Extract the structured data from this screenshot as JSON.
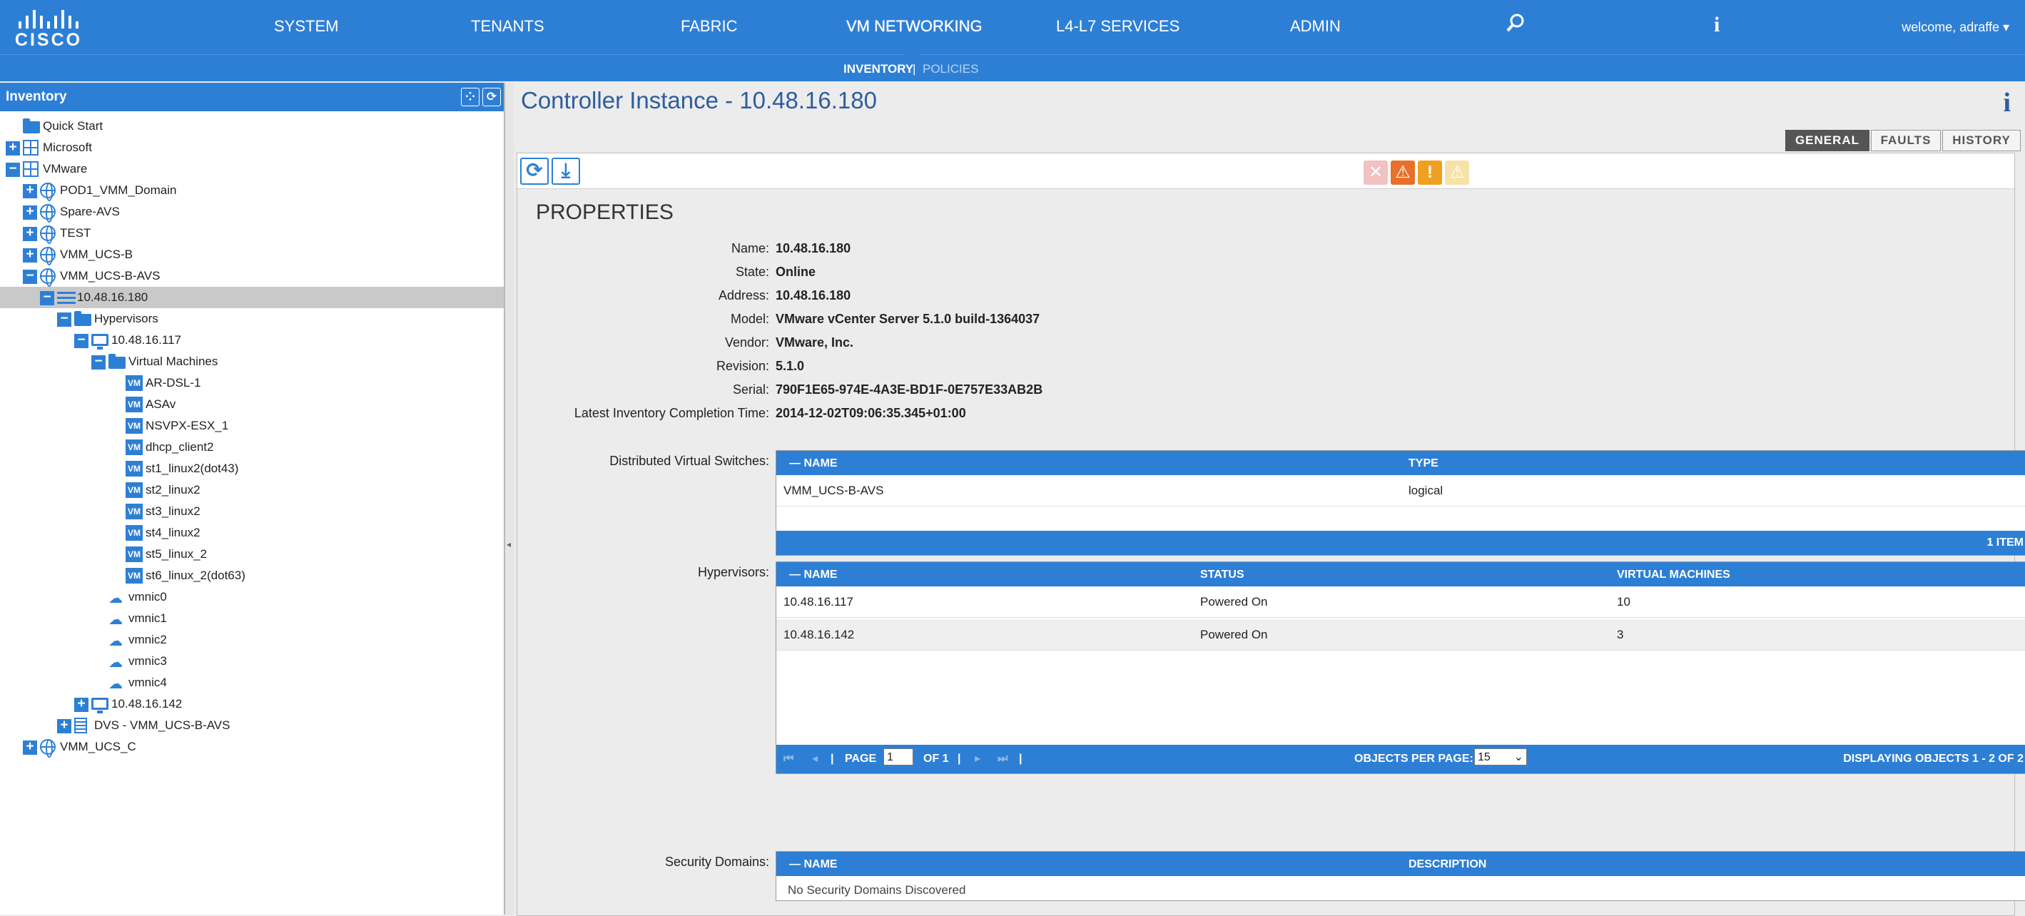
{
  "topnav": {
    "logo": "CISCO",
    "items": [
      "SYSTEM",
      "TENANTS",
      "FABRIC",
      "VM NETWORKING",
      "L4-L7 SERVICES",
      "ADMIN"
    ],
    "user": "welcome, adraffe ▾"
  },
  "subnav": {
    "inventory": "INVENTORY",
    "sep": "|",
    "policies": "POLICIES"
  },
  "left": {
    "title": "Inventory",
    "tree": [
      {
        "label": "Quick Start",
        "icon": "folder-icon",
        "level": 0,
        "toggle": ""
      },
      {
        "label": "Microsoft",
        "icon": "grid-icon",
        "level": 0,
        "toggle": "+"
      },
      {
        "label": "VMware",
        "icon": "vmware-icon",
        "level": 0,
        "toggle": "−"
      },
      {
        "label": "POD1_VMM_Domain",
        "icon": "globe-icon",
        "level": 1,
        "toggle": "+"
      },
      {
        "label": "Spare-AVS",
        "icon": "globe-icon",
        "level": 1,
        "toggle": "+"
      },
      {
        "label": "TEST",
        "icon": "globe-icon",
        "level": 1,
        "toggle": "+"
      },
      {
        "label": "VMM_UCS-B",
        "icon": "globe-icon",
        "level": 1,
        "toggle": "+"
      },
      {
        "label": "VMM_UCS-B-AVS",
        "icon": "globe-icon",
        "level": 1,
        "toggle": "−"
      },
      {
        "label": "10.48.16.180",
        "icon": "controller-icon",
        "level": 2,
        "toggle": "−",
        "selected": true
      },
      {
        "label": "Hypervisors",
        "icon": "folder-icon",
        "level": 3,
        "toggle": "−"
      },
      {
        "label": "10.48.16.117",
        "icon": "monitor-icon",
        "level": 4,
        "toggle": "−"
      },
      {
        "label": "Virtual Machines",
        "icon": "folder-icon",
        "level": 5,
        "toggle": "−"
      },
      {
        "label": "AR-DSL-1",
        "icon": "vm-icon",
        "level": 6,
        "toggle": ""
      },
      {
        "label": "ASAv",
        "icon": "vm-icon",
        "level": 6,
        "toggle": ""
      },
      {
        "label": "NSVPX-ESX_1",
        "icon": "vm-icon",
        "level": 6,
        "toggle": ""
      },
      {
        "label": "dhcp_client2",
        "icon": "vm-icon",
        "level": 6,
        "toggle": ""
      },
      {
        "label": "st1_linux2(dot43)",
        "icon": "vm-icon",
        "level": 6,
        "toggle": ""
      },
      {
        "label": "st2_linux2",
        "icon": "vm-icon",
        "level": 6,
        "toggle": ""
      },
      {
        "label": "st3_linux2",
        "icon": "vm-icon",
        "level": 6,
        "toggle": ""
      },
      {
        "label": "st4_linux2",
        "icon": "vm-icon",
        "level": 6,
        "toggle": ""
      },
      {
        "label": "st5_linux_2",
        "icon": "vm-icon",
        "level": 6,
        "toggle": ""
      },
      {
        "label": "st6_linux_2(dot63)",
        "icon": "vm-icon",
        "level": 6,
        "toggle": ""
      },
      {
        "label": "vmnic0",
        "icon": "cloud-icon",
        "level": 5,
        "toggle": ""
      },
      {
        "label": "vmnic1",
        "icon": "cloud-icon",
        "level": 5,
        "toggle": ""
      },
      {
        "label": "vmnic2",
        "icon": "cloud-icon",
        "level": 5,
        "toggle": ""
      },
      {
        "label": "vmnic3",
        "icon": "cloud-icon",
        "level": 5,
        "toggle": ""
      },
      {
        "label": "vmnic4",
        "icon": "cloud-icon",
        "level": 5,
        "toggle": ""
      },
      {
        "label": "10.48.16.142",
        "icon": "monitor-icon",
        "level": 4,
        "toggle": "+"
      },
      {
        "label": "DVS - VMM_UCS-B-AVS",
        "icon": "doc-icon",
        "level": 3,
        "toggle": "+"
      },
      {
        "label": "VMM_UCS_C",
        "icon": "globe-icon",
        "level": 1,
        "toggle": "+"
      }
    ]
  },
  "main": {
    "title": "Controller Instance - 10.48.16.180",
    "tabs": [
      "GENERAL",
      "FAULTS",
      "HISTORY"
    ],
    "properties_title": "PROPERTIES",
    "props": [
      {
        "label": "Name:",
        "value": "10.48.16.180"
      },
      {
        "label": "State:",
        "value": "Online"
      },
      {
        "label": "Address:",
        "value": "10.48.16.180"
      },
      {
        "label": "Model:",
        "value": "VMware vCenter Server 5.1.0 build-1364037"
      },
      {
        "label": "Vendor:",
        "value": "VMware, Inc."
      },
      {
        "label": "Revision:",
        "value": "5.1.0"
      },
      {
        "label": "Serial:",
        "value": "790F1E65-974E-4A3E-BD1F-0E757E33AB2B"
      },
      {
        "label": "Latest Inventory Completion Time:",
        "value": "2014-12-02T09:06:35.345+01:00"
      }
    ],
    "dvs": {
      "label": "Distributed Virtual Switches:",
      "columns": [
        "NAME",
        "TYPE"
      ],
      "rows": [
        [
          "VMM_UCS-B-AVS",
          "logical"
        ]
      ],
      "footer": "1 ITEM"
    },
    "hypervisors": {
      "label": "Hypervisors:",
      "columns": [
        "NAME",
        "STATUS",
        "VIRTUAL MACHINES"
      ],
      "rows": [
        [
          "10.48.16.117",
          "Powered On",
          "10"
        ],
        [
          "10.48.16.142",
          "Powered On",
          "3"
        ]
      ],
      "pager": {
        "page_label": "PAGE",
        "page": "1",
        "of": "OF 1",
        "per_page_label": "OBJECTS PER PAGE:",
        "per_page": "15",
        "displaying": "DISPLAYING OBJECTS 1 - 2 OF 2"
      }
    },
    "security": {
      "label": "Security Domains:",
      "columns": [
        "NAME",
        "DESCRIPTION"
      ],
      "empty": "No Security Domains Discovered"
    }
  },
  "colors": {
    "accent": "#2d7fd6",
    "fault_critical": "#f2c1c1",
    "fault_major": "#e8702a",
    "fault_minor": "#f0a020",
    "fault_warning": "#f8e2a8"
  }
}
